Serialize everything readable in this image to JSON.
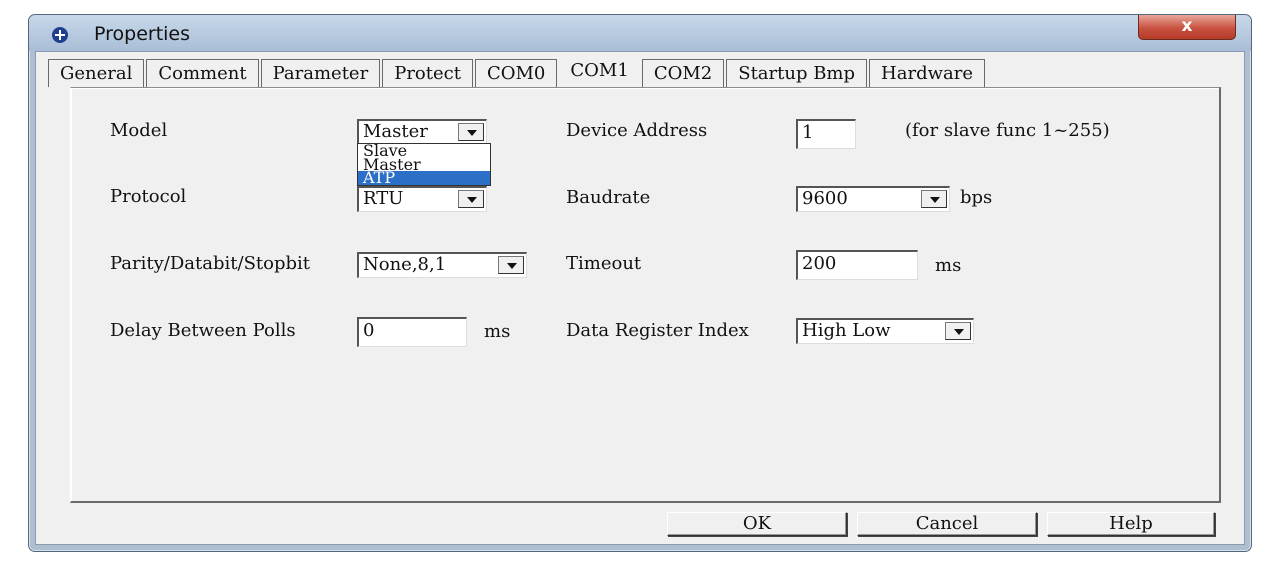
{
  "window": {
    "title": "Properties",
    "close_label": "x"
  },
  "tabs": [
    "General",
    "Comment",
    "Parameter",
    "Protect",
    "COM0",
    "COM1",
    "COM2",
    "Startup Bmp",
    "Hardware"
  ],
  "active_tab": "COM1",
  "form": {
    "model_label": "Model",
    "model_value": "Master",
    "model_options": [
      "Slave",
      "Master",
      "ATP"
    ],
    "model_highlighted": "ATP",
    "protocol_label": "Protocol",
    "protocol_value": "RTU",
    "parity_label": "Parity/Databit/Stopbit",
    "parity_value": "None,8,1",
    "delay_label": "Delay Between Polls",
    "delay_value": "0",
    "delay_unit": "ms",
    "device_address_label": "Device Address",
    "device_address_value": "1",
    "device_address_hint": "(for slave func 1~255)",
    "baudrate_label": "Baudrate",
    "baudrate_value": "9600",
    "baudrate_unit": "bps",
    "timeout_label": "Timeout",
    "timeout_value": "200",
    "timeout_unit": "ms",
    "data_register_label": "Data Register Index",
    "data_register_value": "High Low"
  },
  "buttons": {
    "ok": "OK",
    "cancel": "Cancel",
    "help": "Help"
  },
  "colors": {
    "selection": "#2b6fc6",
    "close": "#c8513f",
    "titlebar": "#aebfd2"
  },
  "icons": {
    "app": "app-logo-icon",
    "dropdown": "chevron-down-icon"
  }
}
